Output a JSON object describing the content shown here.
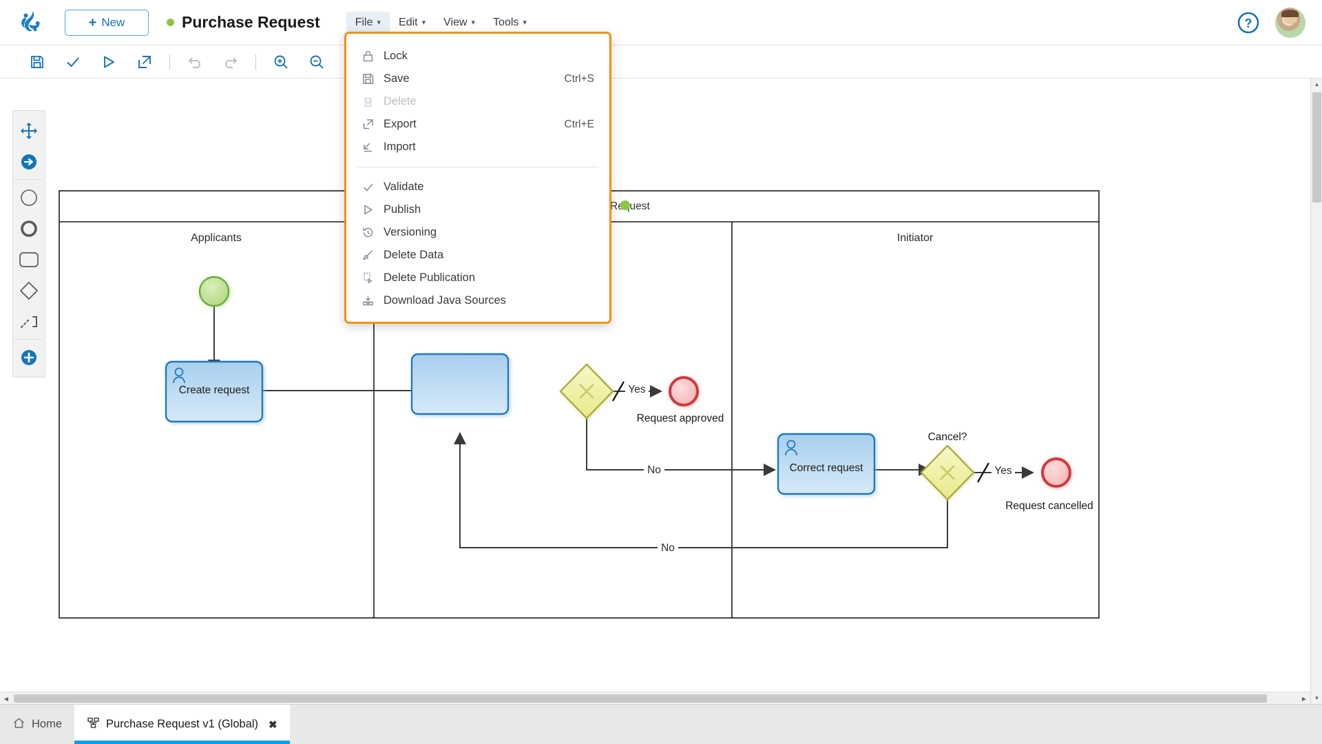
{
  "header": {
    "logo_name": "frog-logo",
    "new_button": "New",
    "document_title": "Purchase Request",
    "status_dot_color": "#8cc63f",
    "menus": [
      {
        "label": "File",
        "active": true
      },
      {
        "label": "Edit",
        "active": false
      },
      {
        "label": "View",
        "active": false
      },
      {
        "label": "Tools",
        "active": false
      }
    ],
    "help_icon": "help-circle-icon",
    "avatar": "user-avatar"
  },
  "toolbar": {
    "buttons": [
      {
        "name": "save-icon",
        "title": "Save",
        "enabled": true
      },
      {
        "name": "validate-icon",
        "title": "Validate",
        "enabled": true
      },
      {
        "name": "publish-icon",
        "title": "Publish",
        "enabled": true
      },
      {
        "name": "export-icon",
        "title": "Export",
        "enabled": true
      },
      {
        "name": "undo-icon",
        "title": "Undo",
        "enabled": false
      },
      {
        "name": "redo-icon",
        "title": "Redo",
        "enabled": false
      },
      {
        "name": "zoom-in-icon",
        "title": "Zoom In",
        "enabled": true
      },
      {
        "name": "zoom-out-icon",
        "title": "Zoom Out",
        "enabled": true
      }
    ]
  },
  "palette": {
    "items": [
      {
        "name": "move-tool-icon",
        "label": "Move"
      },
      {
        "name": "connector-tool-icon",
        "label": "Connector"
      },
      {
        "name": "start-event-icon",
        "label": "Start Event"
      },
      {
        "name": "end-event-icon",
        "label": "End Event"
      },
      {
        "name": "task-icon",
        "label": "Task"
      },
      {
        "name": "gateway-icon",
        "label": "Gateway"
      },
      {
        "name": "association-icon",
        "label": "Association"
      },
      {
        "name": "add-element-icon",
        "label": "Add Element"
      }
    ]
  },
  "file_menu": {
    "groups": [
      [
        {
          "label": "Lock",
          "icon": "lock-icon",
          "shortcut": "",
          "disabled": false
        },
        {
          "label": "Save",
          "icon": "save-icon",
          "shortcut": "Ctrl+S",
          "disabled": false
        },
        {
          "label": "Delete",
          "icon": "trash-icon",
          "shortcut": "",
          "disabled": true
        },
        {
          "label": "Export",
          "icon": "export-icon",
          "shortcut": "Ctrl+E",
          "disabled": false
        },
        {
          "label": "Import",
          "icon": "import-icon",
          "shortcut": "",
          "disabled": false
        }
      ],
      [
        {
          "label": "Validate",
          "icon": "check-icon",
          "shortcut": "",
          "disabled": false
        },
        {
          "label": "Publish",
          "icon": "play-icon",
          "shortcut": "",
          "disabled": false
        },
        {
          "label": "Versioning",
          "icon": "history-icon",
          "shortcut": "",
          "disabled": false
        },
        {
          "label": "Delete Data",
          "icon": "broom-icon",
          "shortcut": "",
          "disabled": false
        },
        {
          "label": "Delete Publication",
          "icon": "unpublish-icon",
          "shortcut": "",
          "disabled": false
        },
        {
          "label": "Download Java Sources",
          "icon": "download-java-icon",
          "shortcut": "",
          "disabled": false
        }
      ]
    ]
  },
  "diagram": {
    "type": "bpmn-process",
    "pool_title": "Purchase Request",
    "pool_status_dot": "#8cc63f",
    "lanes": [
      {
        "name": "Applicants"
      },
      {
        "name": ""
      },
      {
        "name": "Initiator"
      }
    ],
    "nodes": [
      {
        "id": "start",
        "type": "start-event",
        "label": "",
        "lane": "Applicants"
      },
      {
        "id": "create",
        "type": "user-task",
        "label": "Create request",
        "lane": "Applicants"
      },
      {
        "id": "check",
        "type": "user-task",
        "label": "",
        "lane": ""
      },
      {
        "id": "approved_gw",
        "type": "xor-gateway",
        "label": "",
        "lane": ""
      },
      {
        "id": "end_ok",
        "type": "end-event",
        "label": "Request approved",
        "lane": ""
      },
      {
        "id": "correct",
        "type": "user-task",
        "label": "Correct request",
        "lane": "Initiator"
      },
      {
        "id": "cancel_gw",
        "type": "xor-gateway",
        "label": "Cancel?",
        "lane": "Initiator"
      },
      {
        "id": "end_cancel",
        "type": "end-event",
        "label": "Request cancelled",
        "lane": "Initiator"
      }
    ],
    "flows": [
      {
        "from": "start",
        "to": "create",
        "label": ""
      },
      {
        "from": "create",
        "to": "check",
        "label": ""
      },
      {
        "from": "approved_gw",
        "to": "end_ok",
        "label": "Yes"
      },
      {
        "from": "approved_gw",
        "to": "correct",
        "label": "No"
      },
      {
        "from": "cancel_gw",
        "to": "end_cancel",
        "label": "Yes"
      },
      {
        "from": "cancel_gw",
        "to": "check",
        "label": "No"
      }
    ],
    "colors": {
      "task_fill_top": "#a9cfee",
      "task_fill_bottom": "#cde3f6",
      "task_stroke": "#1f79c0",
      "start_fill": "#c6e6a0",
      "start_stroke": "#6aa531",
      "end_fill": "#fac4c4",
      "end_stroke": "#cc3b3b",
      "gateway_fill": "#f2f2a6",
      "gateway_stroke": "#a8a83c",
      "flow_stroke": "#3a3a3a"
    }
  },
  "tabbar": {
    "tabs": [
      {
        "label": "Home",
        "icon": "home-icon",
        "selected": false,
        "closable": false
      },
      {
        "label": "Purchase Request v1 (Global)",
        "icon": "process-icon",
        "selected": true,
        "closable": true
      }
    ],
    "close_label": "✖"
  }
}
